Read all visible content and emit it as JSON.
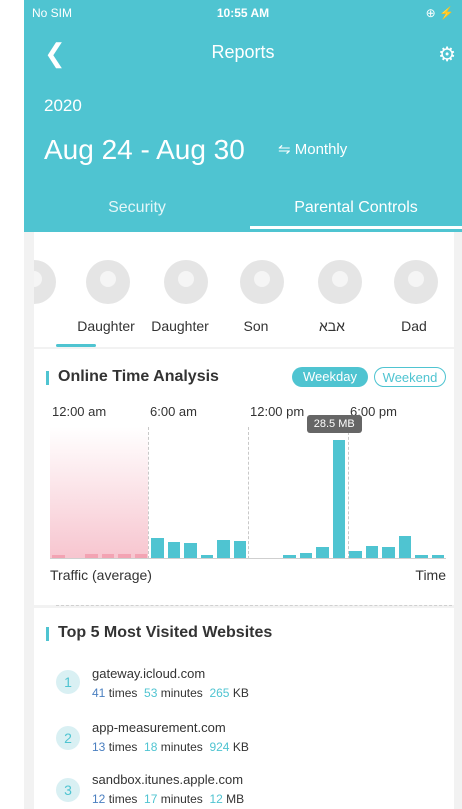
{
  "status_bar": {
    "carrier": "No SIM",
    "time": "10:55 AM",
    "right": "⊕ ⚡"
  },
  "nav": {
    "title": "Reports",
    "back_icon": "chevron-left-icon",
    "settings_icon": "gear-icon"
  },
  "period": {
    "year": "2020",
    "range": "Aug 24 - Aug 30",
    "mode": "⇋ Monthly"
  },
  "tabs": [
    "Security",
    "Parental Controls"
  ],
  "members": [
    "Daughter",
    "Daughter",
    "Son",
    "אבא",
    "Dad"
  ],
  "online_time": {
    "title": "Online Time Analysis",
    "toggle_weekday": "Weekday",
    "toggle_weekend": "Weekend",
    "time_labels": [
      "12:00 am",
      "6:00 am",
      "12:00 pm",
      "6:00 pm"
    ],
    "tooltip": "28.5 MB",
    "y_label": "Traffic (average)",
    "x_label": "Time"
  },
  "chart_data": {
    "type": "bar",
    "title": "Online Time Analysis",
    "xlabel": "Time",
    "ylabel": "Traffic (average)",
    "x_ticks": [
      "12:00 am",
      "6:00 am",
      "12:00 pm",
      "6:00 pm"
    ],
    "hours": [
      0,
      1,
      2,
      3,
      4,
      5,
      6,
      7,
      8,
      9,
      10,
      11,
      12,
      13,
      14,
      15,
      16,
      17,
      18,
      19,
      20,
      21,
      22,
      23
    ],
    "values_mb": [
      0.4,
      0,
      0.9,
      0.9,
      0.9,
      0.9,
      4.8,
      3.8,
      3.6,
      0.5,
      4.4,
      4.2,
      0,
      0,
      0.5,
      1.3,
      2.6,
      28.5,
      1.8,
      2.8,
      2.6,
      5.4,
      0.7,
      0.7
    ],
    "highlight": {
      "hour": 17,
      "label": "28.5 MB"
    },
    "colors": {
      "bar": "#4fc4d1",
      "night_bar": "#f3a3b3",
      "night_shade": "#f7c5cf"
    }
  },
  "top_sites": {
    "title": "Top 5 Most Visited Websites",
    "items": [
      {
        "rank": "1",
        "domain": "gateway.icloud.com",
        "times": "41",
        "times_unit": "times",
        "minutes": "53",
        "minutes_unit": "minutes",
        "size": "265",
        "size_unit": "KB"
      },
      {
        "rank": "2",
        "domain": "app-measurement.com",
        "times": "13",
        "times_unit": "times",
        "minutes": "18",
        "minutes_unit": "minutes",
        "size": "924",
        "size_unit": "KB"
      },
      {
        "rank": "3",
        "domain": "sandbox.itunes.apple.com",
        "times": "12",
        "times_unit": "times",
        "minutes": "17",
        "minutes_unit": "minutes",
        "size": "12",
        "size_unit": "MB"
      }
    ]
  },
  "colors": {
    "accent": "#4fc4d1",
    "header_bg": "#4fc4d1",
    "times_text": "#4a7fc0"
  }
}
